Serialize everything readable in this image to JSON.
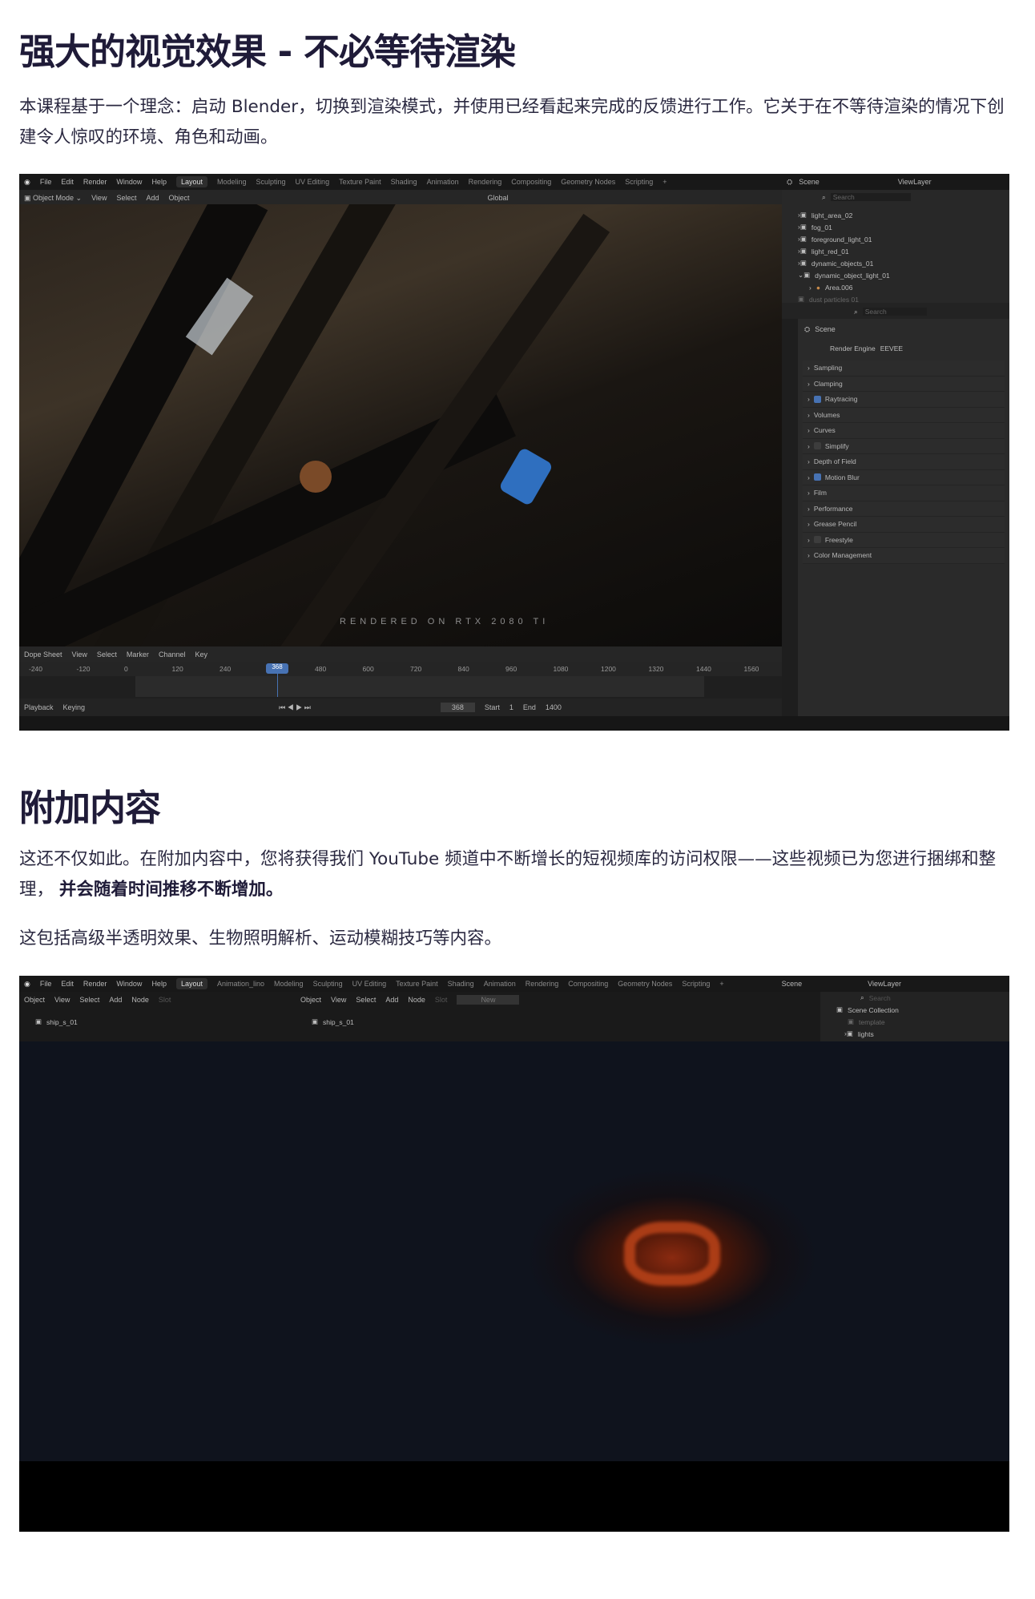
{
  "section1": {
    "heading": "强大的视觉效果 - 不必等待渲染",
    "paragraph": "本课程基于一个理念：启动 Blender，切换到渲染模式，并使用已经看起来完成的反馈进行工作。它关于在不等待渲染的情况下创建令人惊叹的环境、角色和动画。"
  },
  "section2": {
    "heading": "附加内容",
    "paragraph_a": "这还不仅如此。在附加内容中，您将获得我们 YouTube 频道中不断增长的短视频库的访问权限——这些视频已为您进行捆绑和整理，",
    "paragraph_bold": "并会随着时间推移不断增加。",
    "paragraph2": "这包括高级半透明效果、生物照明解析、运动模糊技巧等内容。"
  },
  "shot1": {
    "menu": [
      "File",
      "Edit",
      "Render",
      "Window",
      "Help"
    ],
    "workspaces": [
      "Layout",
      "Modeling",
      "Sculpting",
      "UV Editing",
      "Texture Paint",
      "Shading",
      "Animation",
      "Rendering",
      "Compositing",
      "Geometry Nodes",
      "Scripting",
      "+"
    ],
    "header": {
      "mode": "Object Mode",
      "items": [
        "View",
        "Select",
        "Add",
        "Object"
      ],
      "orientation": "Global"
    },
    "scene": "Scene",
    "view_layer": "ViewLayer",
    "search": "Search",
    "outliner": [
      "light_area_02",
      "fog_01",
      "foreground_light_01",
      "light_red_01",
      "dynamic_objects_01",
      "dynamic_object_light_01",
      "Area.006",
      "dust particles 01"
    ],
    "properties": {
      "title": "Scene",
      "render_engine_label": "Render Engine",
      "render_engine": "EEVEE",
      "panels": [
        {
          "label": "Sampling"
        },
        {
          "label": "Clamping"
        },
        {
          "label": "Raytracing",
          "check": true
        },
        {
          "label": "Volumes"
        },
        {
          "label": "Curves"
        },
        {
          "label": "Simplify",
          "check": false
        },
        {
          "label": "Depth of Field"
        },
        {
          "label": "Motion Blur",
          "check": true
        },
        {
          "label": "Film"
        },
        {
          "label": "Performance"
        },
        {
          "label": "Grease Pencil"
        },
        {
          "label": "Freestyle",
          "check": false
        },
        {
          "label": "Color Management"
        }
      ]
    },
    "watermark": "RENDERED ON RTX 2080 TI",
    "timeline": {
      "editor": "Dope Sheet",
      "items": [
        "View",
        "Select",
        "Marker",
        "Channel",
        "Key"
      ],
      "ticks": [
        "-240",
        "-120",
        "0",
        "120",
        "240",
        "360",
        "480",
        "600",
        "720",
        "840",
        "960",
        "1080",
        "1200",
        "1320",
        "1440",
        "1560"
      ],
      "current": "368",
      "playback": "Playback",
      "keying": "Keying",
      "start_label": "Start",
      "start": "1",
      "end_label": "End",
      "end": "1400"
    }
  },
  "shot2": {
    "menu": [
      "File",
      "Edit",
      "Render",
      "Window",
      "Help"
    ],
    "workspaces": [
      "Layout",
      "Animation_lino",
      "Modeling",
      "Sculpting",
      "UV Editing",
      "Texture Paint",
      "Shading",
      "Animation",
      "Rendering",
      "Compositing",
      "Geometry Nodes",
      "Scripting",
      "+"
    ],
    "scene": "Scene",
    "view_layer": "ViewLayer",
    "search": "Search",
    "node_header": {
      "object": "Object",
      "items": [
        "View",
        "Select",
        "Add",
        "Node"
      ],
      "slot": "Slot",
      "new": "New"
    },
    "object_name": "ship_s_01",
    "outliner": [
      "Scene Collection",
      "template",
      "lights"
    ]
  }
}
